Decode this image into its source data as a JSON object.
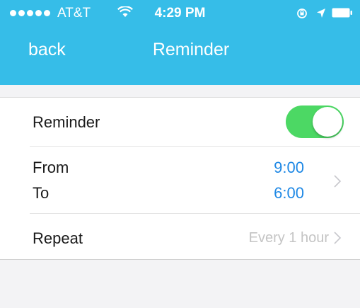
{
  "status_bar": {
    "carrier": "AT&T",
    "time": "4:29 PM"
  },
  "nav": {
    "back_label": "back",
    "title": "Reminder"
  },
  "settings": {
    "reminder_label": "Reminder",
    "reminder_enabled": true,
    "from_label": "From",
    "from_value": "9:00",
    "to_label": "To",
    "to_value": "6:00",
    "repeat_label": "Repeat",
    "repeat_value": "Every 1 hour"
  },
  "colors": {
    "header": "#36bde8",
    "toggle_on": "#4cd864",
    "time_value": "#1e88e5",
    "background": "#f3f3f5"
  },
  "icons": {
    "wifi": "wifi-icon",
    "rotation_lock": "rotation-lock-icon",
    "location": "location-arrow-icon",
    "battery": "battery-icon",
    "chevron": "chevron-right-icon"
  }
}
